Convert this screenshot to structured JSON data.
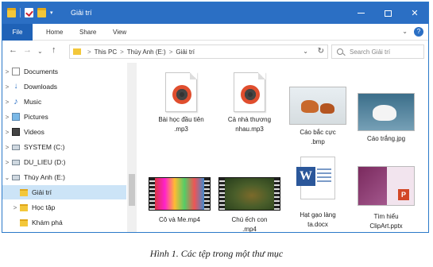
{
  "window": {
    "title": "Giải trí",
    "controls": {
      "minimize": "—",
      "maximize": "☐",
      "close": "✕"
    }
  },
  "ribbon": {
    "tabs": [
      "File",
      "Home",
      "Share",
      "View"
    ],
    "expand": "⌄",
    "help": "?"
  },
  "address": {
    "back": "←",
    "forward": "→",
    "recent": "⌄",
    "up": "↑",
    "crumbs": [
      "This PC",
      "Thùy Anh (E:)",
      "Giải trí"
    ],
    "separator": ">",
    "dropdown": "⌄",
    "refresh": "↻"
  },
  "search": {
    "placeholder": "Search Giải trí"
  },
  "nav": {
    "items": [
      {
        "label": "Documents",
        "expander": ">",
        "icon": "documents-icon"
      },
      {
        "label": "Downloads",
        "expander": ">",
        "icon": "downloads-icon"
      },
      {
        "label": "Music",
        "expander": ">",
        "icon": "music-icon"
      },
      {
        "label": "Pictures",
        "expander": ">",
        "icon": "pictures-icon"
      },
      {
        "label": "Videos",
        "expander": ">",
        "icon": "videos-icon"
      },
      {
        "label": "SYSTEM (C:)",
        "expander": ">",
        "icon": "drive-icon"
      },
      {
        "label": "DU_LIEU (D:)",
        "expander": ">",
        "icon": "drive-icon"
      },
      {
        "label": "Thùy Anh (E:)",
        "expander": "⌄",
        "icon": "drive-icon"
      },
      {
        "label": "Giải trí",
        "expander": "",
        "icon": "folder-icon",
        "selected": true
      },
      {
        "label": "Học tập",
        "expander": ">",
        "icon": "folder-icon"
      },
      {
        "label": "Khám phá",
        "expander": "",
        "icon": "folder-icon"
      }
    ]
  },
  "files": [
    {
      "name": "Bài học đầu tiên .mp3",
      "line1": "Bài học đầu tiên",
      "line2": ".mp3",
      "type": "mp3"
    },
    {
      "name": "Cả nhà thương nhau.mp3",
      "line1": "Cả nhà thương",
      "line2": "nhau.mp3",
      "type": "mp3"
    },
    {
      "name": "Cáo bắc cực .bmp",
      "line1": "Cáo bắc cực",
      "line2": ".bmp",
      "type": "bmp"
    },
    {
      "name": "Cáo trắng.jpg",
      "line1": "Cáo trắng.jpg",
      "line2": "",
      "type": "jpg"
    },
    {
      "name": "Cô và Me.mp4",
      "line1": "Cô và Me.mp4",
      "line2": "",
      "type": "mp4"
    },
    {
      "name": "Chú ếch con .mp4",
      "line1": "Chú ếch con",
      "line2": ".mp4",
      "type": "mp4"
    },
    {
      "name": "Hạt gạo làng ta.docx",
      "line1": "Hạt gạo làng",
      "line2": "ta.docx",
      "type": "docx"
    },
    {
      "name": "Tìm hiểu ClipArt.pptx",
      "line1": "Tìm hiểu",
      "line2": "ClipArt.pptx",
      "type": "pptx"
    }
  ],
  "caption": "Hình 1. Các tệp trong một thư mục",
  "colors": {
    "titlebar": "#2b6fc4",
    "selection": "#cce4f7",
    "folder": "#f3c73a"
  }
}
